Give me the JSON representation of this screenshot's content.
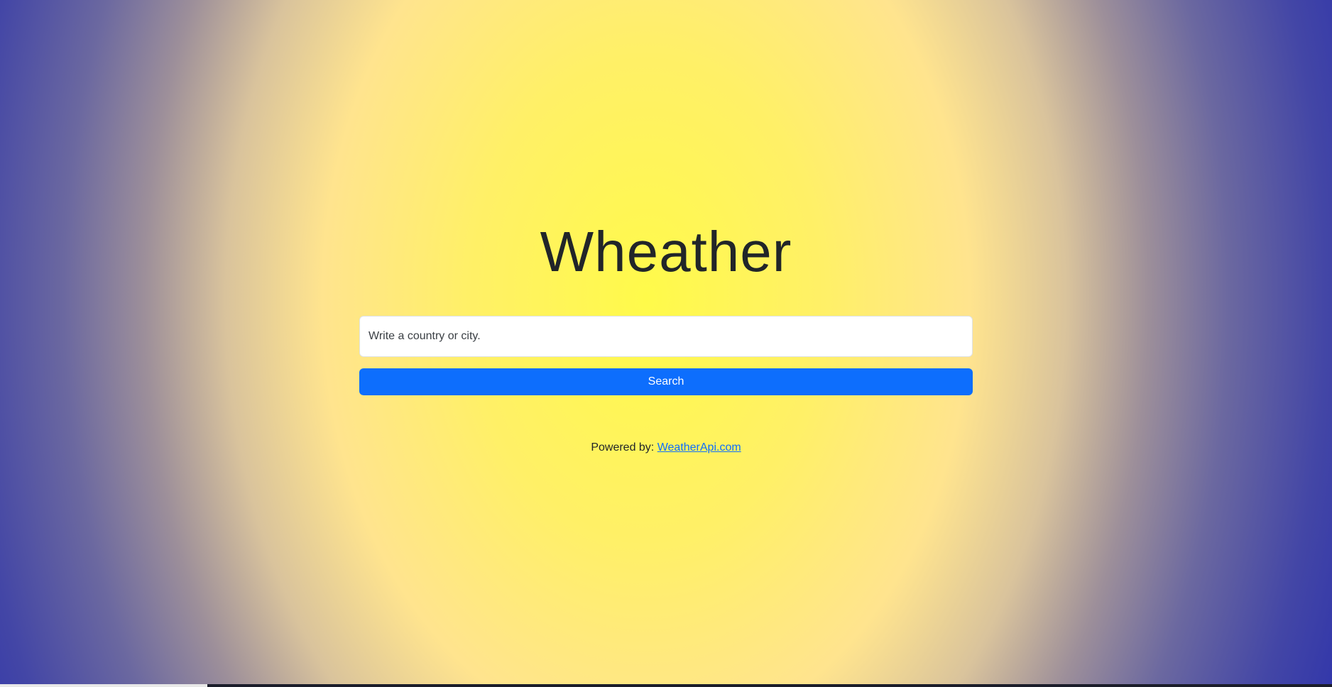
{
  "page": {
    "title": "Wheather"
  },
  "search": {
    "placeholder": "Write a country or city.",
    "value": "",
    "button_label": "Search"
  },
  "footer": {
    "prefix": "Powered by:",
    "link_text": "WeatherApi.com"
  },
  "colors": {
    "accent": "#0d6efd",
    "background_center": "#fffa4a",
    "background_edge": "#2228ae"
  }
}
